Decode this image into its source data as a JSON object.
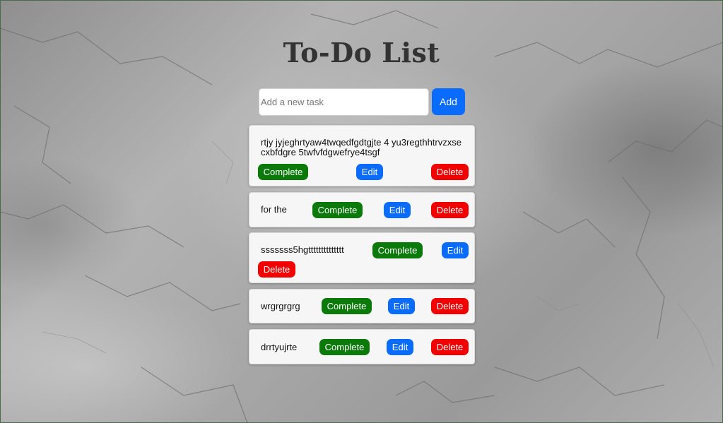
{
  "header": {
    "title": "To-Do List"
  },
  "form": {
    "placeholder": "Add a new task",
    "add_label": "Add"
  },
  "actions": {
    "complete": "Complete",
    "edit": "Edit",
    "delete": "Delete"
  },
  "tasks": [
    {
      "text": "rtjy jyjeghrtyaw4twqedfgdtgjte 4 yu3regthhtrvzxse cxbfdgre 5twfvfdgwefrye4tsgf"
    },
    {
      "text": "for the"
    },
    {
      "text": "sssssss5hgtttttttttttttt"
    },
    {
      "text": "wrgrgrgrg"
    },
    {
      "text": "drrtyujrte"
    }
  ],
  "colors": {
    "complete": "#0b7a0b",
    "edit": "#0a6cff",
    "delete": "#f20000",
    "card": "#f6f6f6"
  }
}
